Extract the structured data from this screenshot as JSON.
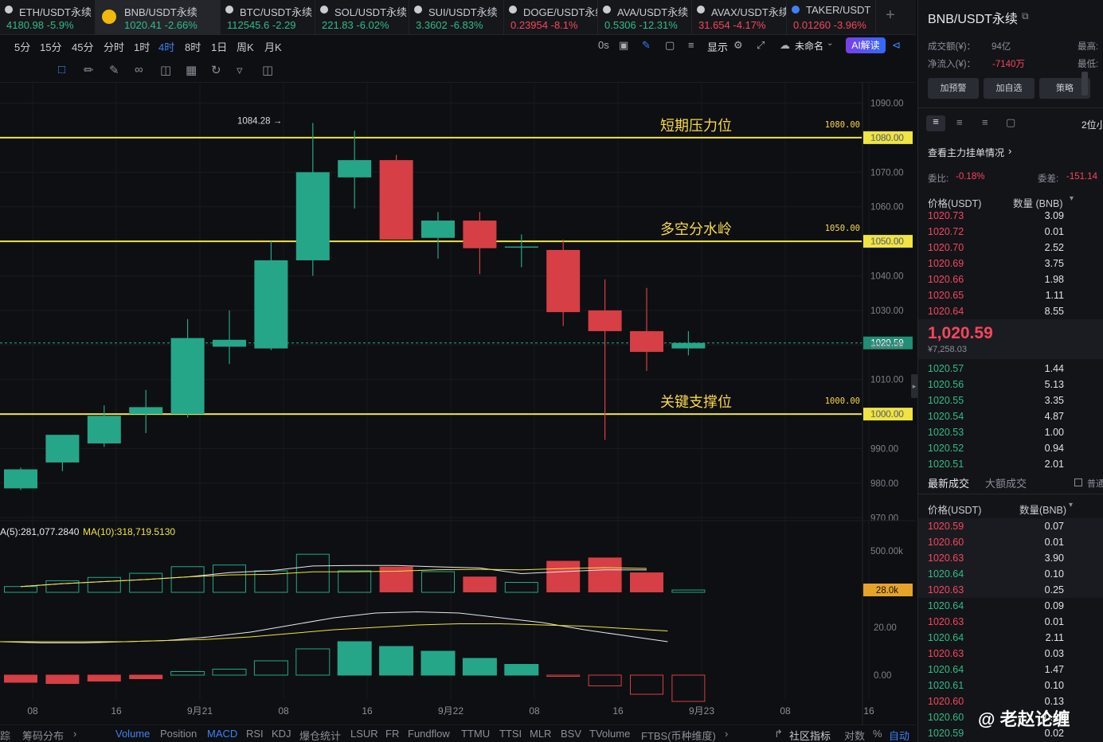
{
  "tabs": [
    {
      "symbol": "ETH/USDT永续",
      "price": "4180.98",
      "change": "-5.9%",
      "dir": "up",
      "icon_color": "#c9ccd3"
    },
    {
      "symbol": "BNB/USDT永续",
      "price": "1020.41",
      "change": "-2.66%",
      "dir": "up",
      "icon_color": "#f0b90b",
      "active": true
    },
    {
      "symbol": "BTC/USDT永续",
      "price": "112545.6",
      "change": "-2.29",
      "dir": "up",
      "icon_color": "#c9ccd3"
    },
    {
      "symbol": "SOL/USDT永续",
      "price": "221.83",
      "change": "-6.02%",
      "dir": "up",
      "icon_color": "#c9ccd3"
    },
    {
      "symbol": "SUI/USDT永续",
      "price": "3.3602",
      "change": "-6.83%",
      "dir": "up",
      "icon_color": "#c9ccd3"
    },
    {
      "symbol": "DOGE/USDT永续",
      "price": "0.23954",
      "change": "-8.1%",
      "dir": "down",
      "icon_color": "#c9ccd3"
    },
    {
      "symbol": "AVA/USDT永续",
      "price": "0.5306",
      "change": "-12.31%",
      "dir": "up",
      "icon_color": "#c9ccd3"
    },
    {
      "symbol": "AVAX/USDT永续",
      "price": "31.654",
      "change": "-4.17%",
      "dir": "down",
      "icon_color": "#c9ccd3"
    },
    {
      "symbol": "TAKER/USDT",
      "price": "0.01260",
      "change": "-3.96%",
      "dir": "down",
      "icon_color": "#3b82f6"
    }
  ],
  "timeframes": [
    "5分",
    "15分",
    "45分",
    "分时",
    "1时",
    "4时",
    "8时",
    "1日",
    "周K",
    "月K"
  ],
  "selected_timeframe": "4时",
  "toolbar_right": {
    "countdown": "0s",
    "display": "显示",
    "layout_name": "未命名",
    "ai_label": "AI解读"
  },
  "indicator_tabs": [
    "Volume",
    "Position",
    "MACD",
    "RSI",
    "KDJ",
    "爆仓统计",
    "LSUR",
    "FR",
    "Fundflow",
    "TTMU",
    "TTSI",
    "MLR",
    "BSV",
    "TVolume",
    "FTBS(币种维度)"
  ],
  "bottom_left": {
    "tracking": "踪",
    "chip_dist": "筹码分布"
  },
  "bottom_right": {
    "community": "社区指标",
    "log": "对数",
    "pct": "%",
    "auto": "自动"
  },
  "chart_data": {
    "type": "candlestick",
    "y_axis": {
      "range": [
        968,
        1092
      ],
      "ticks": [
        "1090.00",
        "1080.00",
        "1070.00",
        "1060.00",
        "1050.00",
        "1040.00",
        "1030.00",
        "1020.00",
        "1010.00",
        "1000.00",
        "990.00",
        "980.00",
        "970.00"
      ],
      "tick_values": [
        1090,
        1080,
        1070,
        1060,
        1050,
        1040,
        1030,
        1020,
        1010,
        1000,
        990,
        980,
        970
      ]
    },
    "x_axis_labels": [
      "08",
      "16",
      "9月21",
      "08",
      "16",
      "9月22",
      "08",
      "16",
      "9月23",
      "08",
      "16"
    ],
    "candles": [
      {
        "o": 978.5,
        "h": 984.5,
        "l": 978.0,
        "c": 984.0
      },
      {
        "o": 986.0,
        "h": 993.5,
        "l": 983.5,
        "c": 994.0
      },
      {
        "o": 991.5,
        "h": 1002.5,
        "l": 990.5,
        "c": 999.5
      },
      {
        "o": 1000.0,
        "h": 1007.0,
        "l": 994.5,
        "c": 1002.0
      },
      {
        "o": 1000.0,
        "h": 1027.5,
        "l": 999.0,
        "c": 1022.0
      },
      {
        "o": 1019.5,
        "h": 1030.0,
        "l": 1014.5,
        "c": 1021.5
      },
      {
        "o": 1019.0,
        "h": 1050.0,
        "l": 1018.5,
        "c": 1044.5
      },
      {
        "o": 1044.5,
        "h": 1084.28,
        "l": 1040.0,
        "c": 1070.0
      },
      {
        "o": 1068.5,
        "h": 1082.0,
        "l": 1059.5,
        "c": 1073.5
      },
      {
        "o": 1073.5,
        "h": 1075.0,
        "l": 1050.5,
        "c": 1050.5
      },
      {
        "o": 1051.0,
        "h": 1058.5,
        "l": 1045.0,
        "c": 1056.0
      },
      {
        "o": 1056.0,
        "h": 1058.5,
        "l": 1040.5,
        "c": 1048.0
      },
      {
        "o": 1048.5,
        "h": 1052.0,
        "l": 1042.5,
        "c": 1048.5
      },
      {
        "o": 1047.5,
        "h": 1050.5,
        "l": 1025.5,
        "c": 1029.5
      },
      {
        "o": 1030.0,
        "h": 1039.0,
        "l": 992.5,
        "c": 1024.0
      },
      {
        "o": 1024.0,
        "h": 1036.5,
        "l": 1012.5,
        "c": 1018.0
      },
      {
        "o": 1019.0,
        "h": 1024.0,
        "l": 1017.0,
        "c": 1020.59
      }
    ],
    "last_price": "1020.59",
    "high_label": "1084.28 →",
    "levels": [
      {
        "value": 1080.0,
        "label": "短期压力位",
        "value_label": "1080.00",
        "tag": "1080.00"
      },
      {
        "value": 1050.0,
        "label": "多空分水岭",
        "value_label": "1050.00",
        "tag": "1050.00"
      },
      {
        "value": 1000.0,
        "label": "关键支撑位",
        "value_label": "1000.00",
        "tag": "1000.00"
      }
    ],
    "volume": {
      "ma5_label": "A(5):281,077.2840",
      "ma10_label": "MA(10):318,719.5130",
      "axis_label": "500.00k",
      "axis_value": 500000,
      "last_tag": "28.0k",
      "values": [
        70000,
        140000,
        180000,
        230000,
        310000,
        330000,
        260000,
        460000,
        260000,
        310000,
        250000,
        190000,
        120000,
        380000,
        420000,
        240000,
        28000
      ]
    },
    "macd": {
      "axis_labels": [
        "20.00",
        "0.00"
      ],
      "axis_values": [
        20,
        0
      ],
      "hist": [
        -3,
        -3.5,
        -2.5,
        -1.5,
        1.5,
        2.5,
        6,
        11,
        14,
        12,
        10,
        7,
        4.5,
        -0.5,
        -4.5,
        -8,
        -11
      ],
      "dif": [
        14,
        13.5,
        13.5,
        14,
        14.5,
        16,
        18,
        21,
        24,
        26,
        26.5,
        26,
        24,
        22,
        19,
        16.5,
        14
      ],
      "dea": [
        14,
        14,
        14,
        14,
        14.5,
        15,
        16,
        17.5,
        19,
        20,
        21,
        21.5,
        21.5,
        21,
        20.5,
        19.5,
        18.5
      ]
    }
  },
  "panel": {
    "title": "BNB/USDT永续",
    "turnover_label": "成交额(¥)：",
    "turnover_value": "94亿",
    "netflow_label": "净流入(¥)：",
    "netflow_value": "-7140万",
    "high_label": "最高:",
    "low_label": "最低:",
    "buttons": [
      "加预警",
      "加自选",
      "策略"
    ],
    "precision": "2位小",
    "main_orders_link": "查看主力挂单情况",
    "weibi_label": "委比:",
    "weibi_value": "-0.18%",
    "weicha_label": "委差:",
    "weicha_value": "-151.14",
    "ob_price_header": "价格(USDT)",
    "ob_qty_header": "数量 (BNB)",
    "asks": [
      [
        "1020.73",
        "3.09"
      ],
      [
        "1020.72",
        "0.01"
      ],
      [
        "1020.70",
        "2.52"
      ],
      [
        "1020.69",
        "3.75"
      ],
      [
        "1020.66",
        "1.98"
      ],
      [
        "1020.65",
        "1.11"
      ],
      [
        "1020.64",
        "8.55"
      ]
    ],
    "mid_price": "1,020.59",
    "mid_cny": "¥7,258.03",
    "bids": [
      [
        "1020.57",
        "1.44"
      ],
      [
        "1020.56",
        "5.13"
      ],
      [
        "1020.55",
        "3.35"
      ],
      [
        "1020.54",
        "4.87"
      ],
      [
        "1020.53",
        "1.00"
      ],
      [
        "1020.52",
        "0.94"
      ],
      [
        "1020.51",
        "2.01"
      ]
    ],
    "trade_tabs": [
      "最新成交",
      "大额成交"
    ],
    "ordinary_label": "普通",
    "tr_price_header": "价格(USDT)",
    "tr_qty_header": "数量(BNB)",
    "trades": [
      [
        "1020.59",
        "0.07",
        "down"
      ],
      [
        "1020.60",
        "0.01",
        "down"
      ],
      [
        "1020.63",
        "3.90",
        "down"
      ],
      [
        "1020.64",
        "0.10",
        "up"
      ],
      [
        "1020.63",
        "0.25",
        "down"
      ],
      [
        "1020.64",
        "0.09",
        "up"
      ],
      [
        "1020.63",
        "0.01",
        "down"
      ],
      [
        "1020.64",
        "2.11",
        "up"
      ],
      [
        "1020.63",
        "0.03",
        "down"
      ],
      [
        "1020.64",
        "1.47",
        "up"
      ],
      [
        "1020.61",
        "0.10",
        "up"
      ],
      [
        "1020.60",
        "0.13",
        "down"
      ],
      [
        "1020.60",
        "0.39",
        "up"
      ],
      [
        "1020.59",
        "0.02",
        "up"
      ]
    ],
    "watermark": "@ 老赵论缠"
  },
  "colors": {
    "up": "#26a688",
    "down": "#d53f45",
    "level": "#f0e442",
    "level_text": "#f6d84a",
    "accent": "#3b82f6"
  }
}
